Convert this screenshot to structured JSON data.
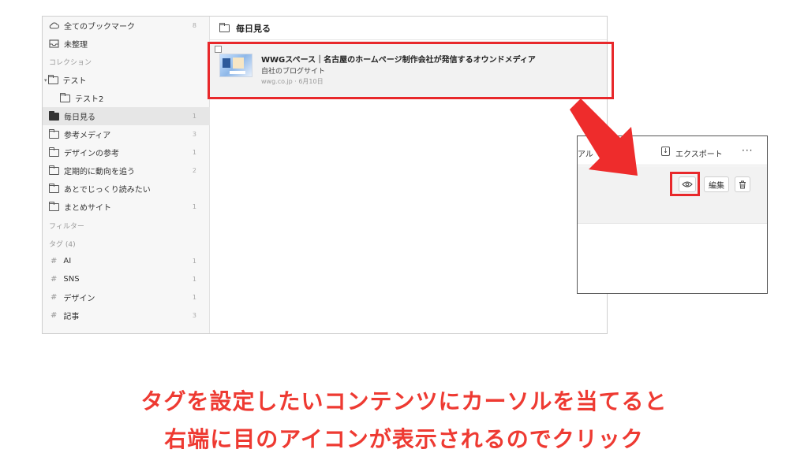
{
  "sidebar": {
    "all_bookmarks": {
      "label": "全てのブックマーク",
      "count": "8"
    },
    "unsorted": {
      "label": "未整理"
    },
    "collections_heading": "コレクション",
    "collections": [
      {
        "label": "テスト",
        "count": ""
      },
      {
        "label": "テスト2",
        "count": ""
      },
      {
        "label": "毎日見る",
        "count": "1",
        "active": true
      },
      {
        "label": "参考メディア",
        "count": "3"
      },
      {
        "label": "デザインの参考",
        "count": "1"
      },
      {
        "label": "定期的に動向を追う",
        "count": "2"
      },
      {
        "label": "あとでじっくり読みたい",
        "count": ""
      },
      {
        "label": "まとめサイト",
        "count": "1"
      }
    ],
    "filters_heading": "フィルター",
    "tags_heading": "タグ (4)",
    "tags": [
      {
        "label": "AI",
        "count": "1"
      },
      {
        "label": "SNS",
        "count": "1"
      },
      {
        "label": "デザイン",
        "count": "1"
      },
      {
        "label": "記事",
        "count": "3"
      }
    ]
  },
  "content": {
    "title": "毎日見る",
    "bookmark": {
      "title": "WWGスペース｜名古屋のホームページ制作会社が発信するオウンドメディア",
      "subtitle": "自社のブログサイト",
      "meta": "wwg.co.jp · 6月10日"
    }
  },
  "inset": {
    "partial_label": "アル",
    "export_label": "エクスポート",
    "more_label": "···",
    "edit_label": "編集"
  },
  "caption": {
    "line1": "タグを設定したいコンテンツにカーソルを当てると",
    "line2": "右端に目のアイコンが表示されるのでクリック"
  },
  "colors": {
    "highlight": "#e8282b",
    "caption": "#ee3a32"
  }
}
